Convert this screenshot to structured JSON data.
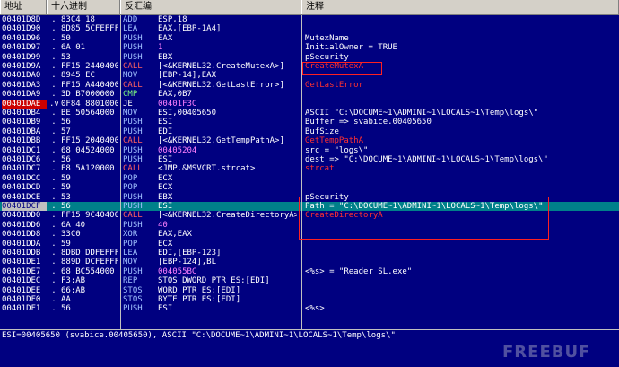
{
  "header": {
    "col_address": "地址",
    "col_hex": "十六进制",
    "col_disasm": "反汇编",
    "col_comment": "注释"
  },
  "rows": [
    {
      "addr": "00401D8D",
      "mark": ".",
      "hex": "83C4 18",
      "mnem": "ADD",
      "args": "ESP,18",
      "cmt": ""
    },
    {
      "addr": "00401D90",
      "mark": ".",
      "hex": "8D85 5CFEFFFF",
      "mnem": "LEA",
      "args": "EAX,[EBP-1A4]",
      "cmt": ""
    },
    {
      "addr": "00401D96",
      "mark": ".",
      "hex": "50",
      "mnem": "PUSH",
      "args": "EAX",
      "cmt": "MutexName"
    },
    {
      "addr": "00401D97",
      "mark": ".",
      "hex": "6A 01",
      "mnem": "PUSH",
      "args": "1",
      "cmt": "InitialOwner = TRUE"
    },
    {
      "addr": "00401D99",
      "mark": ".",
      "hex": "53",
      "mnem": "PUSH",
      "args": "EBX",
      "cmt": "pSecurity"
    },
    {
      "addr": "00401D9A",
      "mark": ".",
      "hex": "FF15 24404000",
      "mnem": "CALL",
      "args": "[<&KERNEL32.CreateMutexA>]",
      "cmt": "CreateMutexA"
    },
    {
      "addr": "00401DA0",
      "mark": ".",
      "hex": "8945 EC",
      "mnem": "MOV",
      "args": "[EBP-14],EAX",
      "cmt": ""
    },
    {
      "addr": "00401DA3",
      "mark": ".",
      "hex": "FF15 A4404000",
      "mnem": "CALL",
      "args": "[<&KERNEL32.GetLastError>]",
      "cmt": "GetLastError"
    },
    {
      "addr": "00401DA9",
      "mark": ".",
      "hex": "3D B7000000",
      "mnem": "CMP",
      "args": "EAX,0B7",
      "cmt": ""
    },
    {
      "addr": "00401DAE",
      "mark": ".v",
      "hex": "0F84 88010000",
      "mnem": "JE",
      "args": "00401F3C",
      "cmt": ""
    },
    {
      "addr": "00401DB4",
      "mark": ".",
      "hex": "BE 50564000",
      "mnem": "MOV",
      "args": "ESI,00405650",
      "cmt": "ASCII \"C:\\DOCUME~1\\ADMINI~1\\LOCALS~1\\Temp\\logs\\\""
    },
    {
      "addr": "00401DB9",
      "mark": ".",
      "hex": "56",
      "mnem": "PUSH",
      "args": "ESI",
      "cmt": "Buffer => svabice.00405650"
    },
    {
      "addr": "00401DBA",
      "mark": ".",
      "hex": "57",
      "mnem": "PUSH",
      "args": "EDI",
      "cmt": "BufSize"
    },
    {
      "addr": "00401DBB",
      "mark": ".",
      "hex": "FF15 20404000",
      "mnem": "CALL",
      "args": "[<&KERNEL32.GetTempPathA>]",
      "cmt": "GetTempPathA"
    },
    {
      "addr": "00401DC1",
      "mark": ".",
      "hex": "68 04524000",
      "mnem": "PUSH",
      "args": "00405204",
      "cmt": "src = \"logs\\\""
    },
    {
      "addr": "00401DC6",
      "mark": ".",
      "hex": "56",
      "mnem": "PUSH",
      "args": "ESI",
      "cmt": "dest => \"C:\\DOCUME~1\\ADMINI~1\\LOCALS~1\\Temp\\logs\\\""
    },
    {
      "addr": "00401DC7",
      "mark": ".",
      "hex": "E8 5A120000",
      "mnem": "CALL",
      "args": "<JMP.&MSVCRT.strcat>",
      "cmt": "strcat"
    },
    {
      "addr": "00401DCC",
      "mark": ".",
      "hex": "59",
      "mnem": "POP",
      "args": "ECX",
      "cmt": ""
    },
    {
      "addr": "00401DCD",
      "mark": ".",
      "hex": "59",
      "mnem": "POP",
      "args": "ECX",
      "cmt": ""
    },
    {
      "addr": "00401DCE",
      "mark": ".",
      "hex": "53",
      "mnem": "PUSH",
      "args": "EBX",
      "cmt": "pSecurity"
    },
    {
      "addr": "00401DCF",
      "mark": ".",
      "hex": "56",
      "mnem": "PUSH",
      "args": "ESI",
      "cmt": "Path = \"C:\\DOCUME~1\\ADMINI~1\\LOCALS~1\\Temp\\logs\\\""
    },
    {
      "addr": "00401DD0",
      "mark": ".",
      "hex": "FF15 9C404000",
      "mnem": "CALL",
      "args": "[<&KERNEL32.CreateDirectoryA>]",
      "cmt": "CreateDirectoryA"
    },
    {
      "addr": "00401DD6",
      "mark": ".",
      "hex": "6A 40",
      "mnem": "PUSH",
      "args": "40",
      "cmt": ""
    },
    {
      "addr": "00401DD8",
      "mark": ".",
      "hex": "33C0",
      "mnem": "XOR",
      "args": "EAX,EAX",
      "cmt": ""
    },
    {
      "addr": "00401DDA",
      "mark": ".",
      "hex": "59",
      "mnem": "POP",
      "args": "ECX",
      "cmt": ""
    },
    {
      "addr": "00401DDB",
      "mark": ".",
      "hex": "8DBD DDFEFFFF",
      "mnem": "LEA",
      "args": "EDI,[EBP-123]",
      "cmt": ""
    },
    {
      "addr": "00401DE1",
      "mark": ".",
      "hex": "889D DCFEFFFF",
      "mnem": "MOV",
      "args": "[EBP-124],BL",
      "cmt": ""
    },
    {
      "addr": "00401DE7",
      "mark": ".",
      "hex": "68 BC554000",
      "mnem": "PUSH",
      "args": "004055BC",
      "cmt": "<%s> = \"Reader_SL.exe\""
    },
    {
      "addr": "00401DEC",
      "mark": ".",
      "hex": "F3:AB",
      "mnem": "REP",
      "args": "STOS DWORD PTR ES:[EDI]",
      "cmt": ""
    },
    {
      "addr": "00401DEE",
      "mark": ".",
      "hex": "66:AB",
      "mnem": "STOS",
      "args": "WORD PTR ES:[EDI]",
      "cmt": ""
    },
    {
      "addr": "00401DF0",
      "mark": ".",
      "hex": "AA",
      "mnem": "STOS",
      "args": "BYTE PTR ES:[EDI]",
      "cmt": ""
    },
    {
      "addr": "00401DF1",
      "mark": ".",
      "hex": "56",
      "mnem": "PUSH",
      "args": "ESI",
      "cmt": "<%s>"
    }
  ],
  "status": {
    "text": "ESI=00405650 (svabice.00405650), ASCII \"C:\\DOCUME~1\\ADMINI~1\\LOCALS~1\\Temp\\logs\\\""
  },
  "watermark": "FREEBUF",
  "colors": {
    "background": "#000080",
    "selected_address": "#cc0000",
    "current_row": "#00808a",
    "annotation_box": "#ff2020"
  }
}
